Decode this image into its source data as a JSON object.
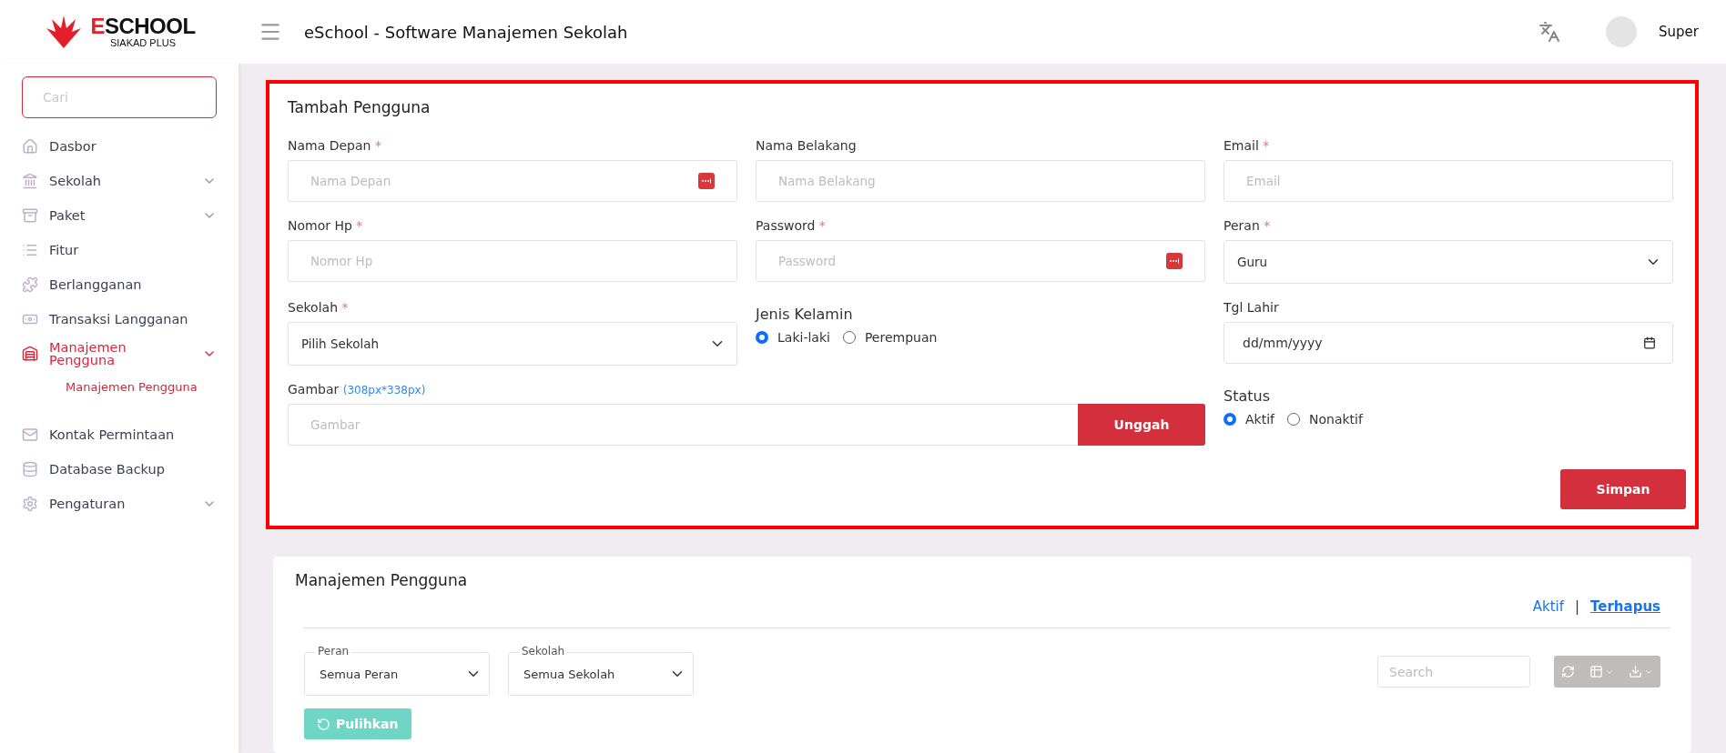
{
  "brand": {
    "accent": "E",
    "rest": "SCHOOL",
    "subtitle": "SIAKAD PLUS"
  },
  "header": {
    "title": "eSchool - Software Manajemen Sekolah",
    "user": "Super"
  },
  "sidebar": {
    "search": {
      "placeholder": "Cari"
    },
    "items": [
      {
        "label": "Dasbor",
        "submenu": false,
        "selected": false
      },
      {
        "label": "Sekolah",
        "submenu": true,
        "selected": false
      },
      {
        "label": "Paket",
        "submenu": true,
        "selected": false
      },
      {
        "label": "Fitur",
        "submenu": false,
        "selected": false
      },
      {
        "label": "Berlangganan",
        "submenu": false,
        "selected": false
      },
      {
        "label": "Transaksi Langganan",
        "submenu": false,
        "selected": false
      },
      {
        "label": "Manajemen Pengguna",
        "submenu": true,
        "selected": true,
        "children": [
          {
            "label": "Manajemen Pengguna",
            "selected": true
          }
        ]
      },
      {
        "label": "Kontak Permintaan",
        "submenu": false,
        "selected": false
      },
      {
        "label": "Database Backup",
        "submenu": false,
        "selected": false
      },
      {
        "label": "Pengaturan",
        "submenu": true,
        "selected": false
      }
    ]
  },
  "form": {
    "title": "Tambah Pengguna",
    "fields": [
      {
        "kind": "text",
        "label": "Nama Depan",
        "marker": "*",
        "placeholder": "Nama Depan",
        "autofill_icon": true
      },
      {
        "kind": "text",
        "label": "Nama Belakang",
        "placeholder": "Nama Belakang"
      },
      {
        "kind": "text",
        "label": "Email",
        "marker": "*",
        "placeholder": "Email"
      },
      {
        "kind": "text",
        "label": "Nomor Hp",
        "marker": "*",
        "placeholder": "Nomor Hp"
      },
      {
        "kind": "text",
        "label": "Password",
        "marker": "*",
        "placeholder": "Password",
        "autofill_icon": true
      },
      {
        "kind": "select",
        "label": "Peran",
        "marker": "*",
        "value": "Guru"
      },
      {
        "kind": "select",
        "label": "Sekolah",
        "marker": "*",
        "value": "Pilih Sekolah"
      },
      {
        "kind": "radio",
        "label": "Jenis Kelamin",
        "options": [
          {
            "label": "Laki-laki",
            "selected": true
          },
          {
            "label": "Perempuan",
            "selected": false
          }
        ]
      },
      {
        "kind": "date",
        "label": "Tgl Lahir",
        "value": "dd/mm/yyyy"
      },
      {
        "kind": "file",
        "label": "Gambar",
        "hint": "(308px*338px)",
        "placeholder": "Gambar",
        "button": "Unggah"
      },
      {
        "kind": "radio",
        "label": "Status",
        "options": [
          {
            "label": "Aktif",
            "selected": true
          },
          {
            "label": "Nonaktif",
            "selected": false
          }
        ]
      }
    ],
    "submit": "Simpan"
  },
  "list": {
    "title": "Manajemen Pengguna",
    "views": [
      {
        "label": "Aktif",
        "selected": false
      },
      {
        "label": "Terhapus",
        "selected": true
      }
    ],
    "separator": "|",
    "filters": [
      {
        "label": "Peran",
        "value": "Semua Peran"
      },
      {
        "label": "Sekolah",
        "value": "Semua Sekolah"
      }
    ],
    "search": {
      "placeholder": "Search"
    },
    "restore": "Pulihkan"
  }
}
